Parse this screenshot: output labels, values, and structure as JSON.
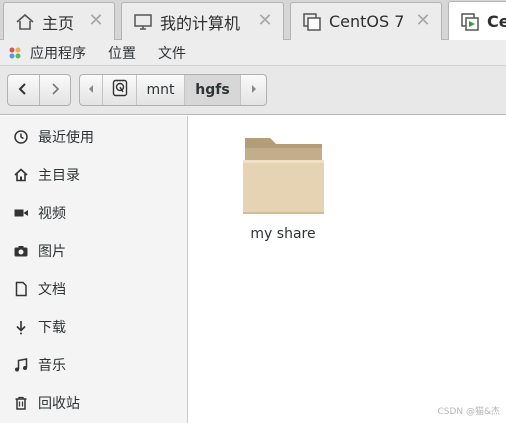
{
  "tabs": [
    {
      "label": "主页",
      "icon": "home-icon",
      "active": false
    },
    {
      "label": "我的计算机",
      "icon": "monitor-icon",
      "active": false
    },
    {
      "label": "CentOS 7",
      "icon": "vm-icon",
      "active": false
    },
    {
      "label": "Ce",
      "icon": "vm-running-icon",
      "active": true
    }
  ],
  "menubar": {
    "applications": "应用程序",
    "places": "位置",
    "file": "文件"
  },
  "toolbar": {
    "back_icon": "chevron-left-icon",
    "forward_icon": "chevron-right-icon",
    "path_left_icon": "caret-left-icon",
    "path_right_icon": "caret-right-icon",
    "root_icon": "drive-icon",
    "crumbs": [
      "mnt",
      "hgfs"
    ],
    "active_crumb": "hgfs"
  },
  "sidebar": {
    "items": [
      {
        "label": "最近使用",
        "icon": "clock-icon"
      },
      {
        "label": "主目录",
        "icon": "home-icon"
      },
      {
        "label": "视频",
        "icon": "video-icon"
      },
      {
        "label": "图片",
        "icon": "camera-icon"
      },
      {
        "label": "文档",
        "icon": "document-icon"
      },
      {
        "label": "下载",
        "icon": "download-icon"
      },
      {
        "label": "音乐",
        "icon": "music-icon"
      },
      {
        "label": "回收站",
        "icon": "trash-icon"
      }
    ]
  },
  "files": [
    {
      "name": "my share",
      "icon": "folder-icon"
    }
  ],
  "watermark": "CSDN @猫&杰",
  "colors": {
    "folder_front": "#e6d3b4",
    "folder_back": "#c9b591",
    "accent_green": "#3a9b3a"
  }
}
